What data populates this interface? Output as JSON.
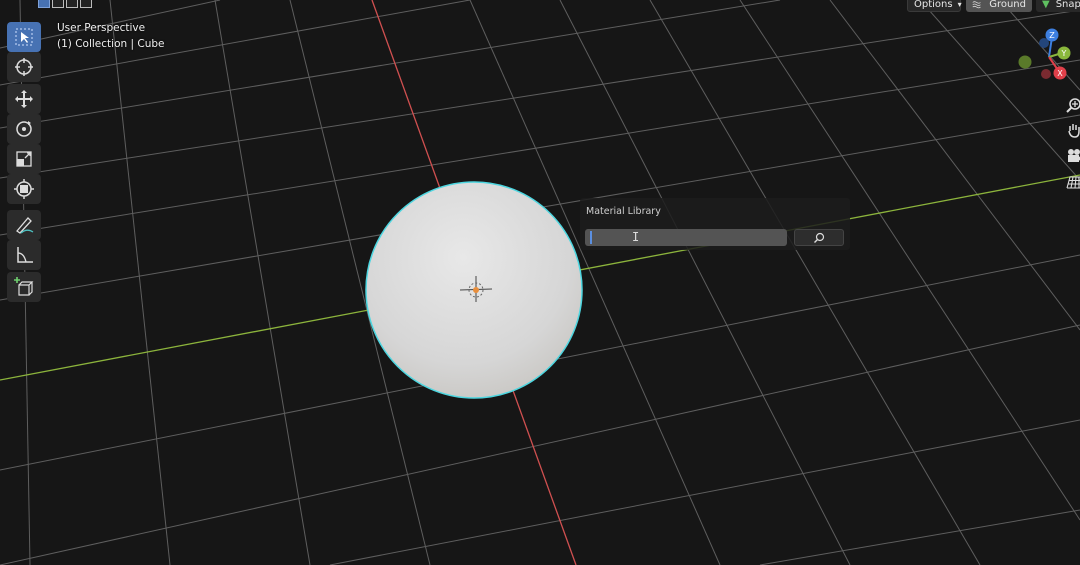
{
  "viewport": {
    "view_name": "User Perspective",
    "collection_label": "(1) Collection | Cube",
    "colors": {
      "background": "#161616",
      "grid": "#5e5e5e",
      "x_axis": "#d05050",
      "y_axis": "#8cb43c",
      "selection_outline": "#4dd6e0",
      "sphere": "#dcdcdc"
    }
  },
  "header": {
    "options_label": "Options",
    "ground_label": "Ground",
    "snap_label": "Snap"
  },
  "toolbar": {
    "tools": [
      "select-box",
      "cursor",
      "move",
      "rotate",
      "scale",
      "transform",
      "annotate",
      "measure",
      "add-cube"
    ],
    "active_tool": "select-box"
  },
  "gizmo": {
    "axes": [
      "Z",
      "Y",
      "X"
    ],
    "colors": {
      "x": "#e0404a",
      "y": "#8ab83c",
      "z": "#3d7fe0"
    }
  },
  "navigation": [
    "zoom",
    "pan",
    "camera",
    "ortho-grid"
  ],
  "material_library": {
    "title": "Material Library",
    "search_value": ""
  }
}
